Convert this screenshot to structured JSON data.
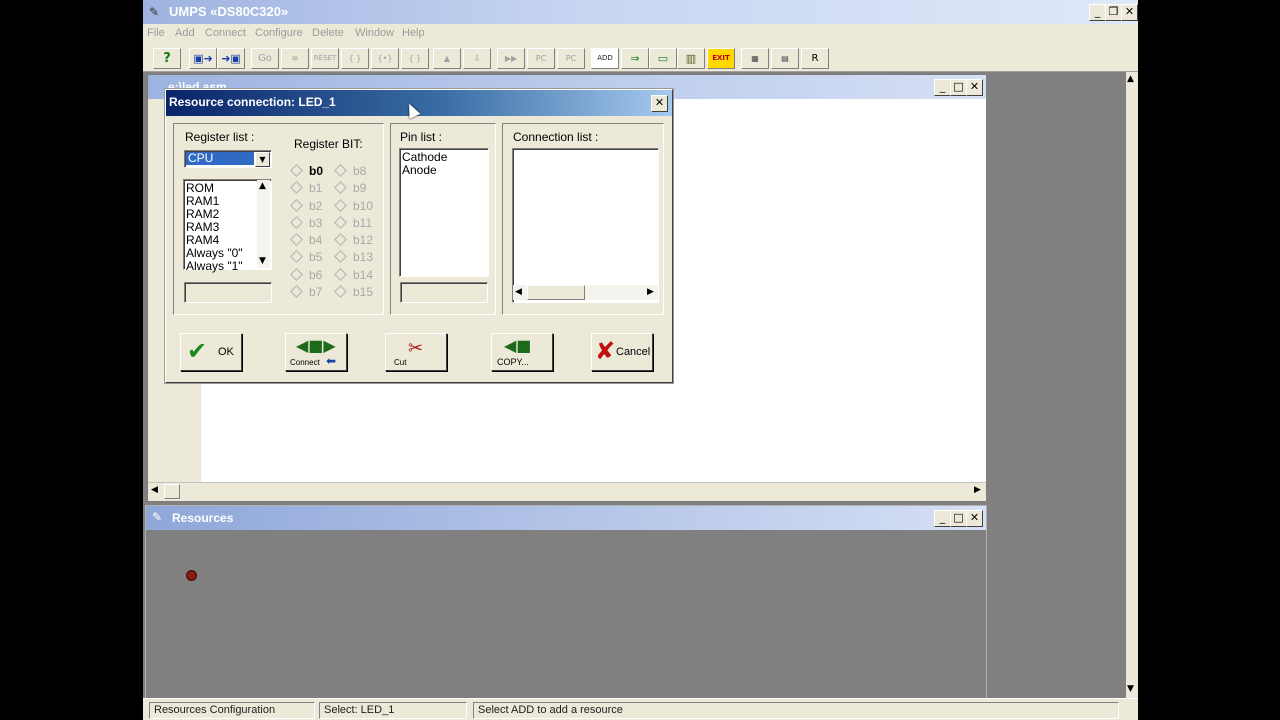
{
  "app": {
    "title": "UMPS «DS80C320»",
    "window_buttons": {
      "minimize": "_",
      "restore": "❐",
      "close": "✕"
    }
  },
  "menu": [
    "File",
    "Add",
    "Connect",
    "Configure",
    "Delete",
    "Window",
    "Help"
  ],
  "toolbar": {
    "go": "Go",
    "reset": "RESET",
    "brace1": "{ }",
    "brace2": "{•}",
    "brace3": "{ }",
    "pc1": "PC",
    "pc2": "PC",
    "add": "ADD",
    "exit": "EXIT",
    "r": "R"
  },
  "child_window": {
    "title": "e:\\led.asm"
  },
  "resources": {
    "title": "Resources"
  },
  "dialog": {
    "title": "Resource connection: LED_1",
    "close": "✕",
    "register_list_label": "Register list :",
    "register_select_value": "CPU",
    "register_items": [
      "ROM",
      "RAM1",
      "RAM2",
      "RAM3",
      "RAM4",
      "Always \"0\"",
      "Always \"1\""
    ],
    "register_bit_label": "Register BIT:",
    "bits_left": [
      "b0",
      "b1",
      "b2",
      "b3",
      "b4",
      "b5",
      "b6",
      "b7"
    ],
    "bits_right": [
      "b8",
      "b9",
      "b10",
      "b11",
      "b12",
      "b13",
      "b14",
      "b15"
    ],
    "pin_list_label": "Pin list :",
    "pins": [
      "Cathode",
      "Anode"
    ],
    "connection_list_label": "Connection list :",
    "buttons": {
      "ok": "OK",
      "connect": "Connect",
      "cut": "Cut",
      "copy": "COPY...",
      "cancel": "Cancel"
    }
  },
  "status": {
    "left": "Resources Configuration",
    "middle": "Select: LED_1",
    "right": "Select ADD to add a resource"
  },
  "colors": {
    "dialog_title": "#0a246a",
    "app_title": "#9eb3e0",
    "led": "#8b1a10"
  }
}
